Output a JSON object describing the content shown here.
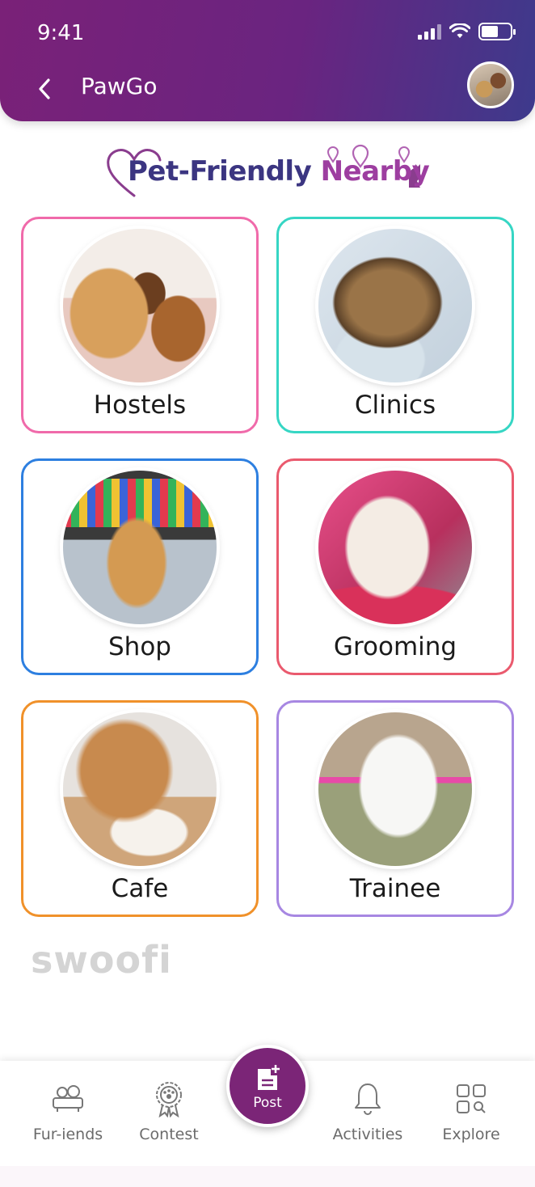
{
  "status_bar": {
    "time": "9:41"
  },
  "header": {
    "back_icon": "chevron-left-icon",
    "title": "PawGo",
    "avatar_icon": "user-avatar"
  },
  "section": {
    "title_part1": "Pet-Friendly",
    "title_part2": "Nearby"
  },
  "categories": [
    {
      "label": "Hostels",
      "border_color": "#f06aaa"
    },
    {
      "label": "Clinics",
      "border_color": "#36d6c4"
    },
    {
      "label": "Shop",
      "border_color": "#2d7fe0"
    },
    {
      "label": "Grooming",
      "border_color": "#ea5a6e"
    },
    {
      "label": "Cafe",
      "border_color": "#f0912a"
    },
    {
      "label": "Trainee",
      "border_color": "#a787e2"
    }
  ],
  "watermark": "swoofi",
  "bottom_nav": {
    "items": [
      {
        "label": "Fur-iends",
        "icon": "pets-sofa-icon"
      },
      {
        "label": "Contest",
        "icon": "award-ribbon-icon"
      },
      {
        "label": "Post",
        "icon": "add-post-icon"
      },
      {
        "label": "Activities",
        "icon": "bell-icon"
      },
      {
        "label": "Explore",
        "icon": "grid-search-icon"
      }
    ]
  },
  "colors": {
    "header_start": "#7a2178",
    "header_end": "#3d3a8c",
    "post_button": "#7b2577",
    "heading_dark": "#3b3581",
    "heading_accent": "#9d3ea0"
  }
}
